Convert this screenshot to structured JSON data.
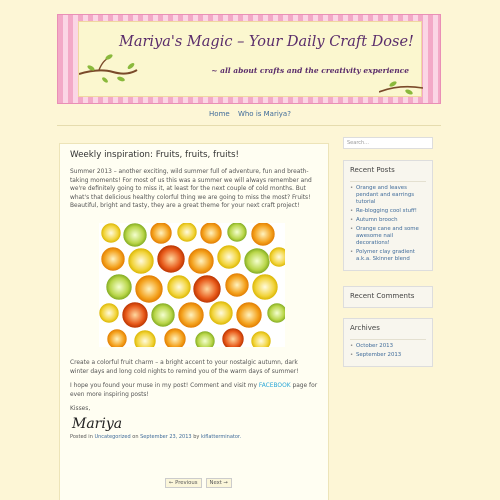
{
  "header": {
    "title": "Mariya's Magic – Your Daily Craft Dose!",
    "subtitle": "~ all about crafts and the creativity experience"
  },
  "nav": {
    "items": [
      {
        "label": "Home"
      },
      {
        "label": "Who is Mariya?"
      }
    ]
  },
  "post": {
    "title": "Weekly inspiration: Fruits, fruits, fruits!",
    "paragraph1": "Summer 2013 – another exciting, wild summer full of adventure, fun and breath-taking moments! For most of us this was a summer we will always remember and we're definitely going to miss it, at least for the next couple of cold months. But what's that delicious healthy colorful thing we are going to miss the most? Fruits! Beautiful, bright and tasty, they are a great theme for your next craft project!",
    "paragraph2": "Create a colorful fruit charm – a bright accent to your nostalgic autumn, dark winter days and long cold nights to remind you of the warm days of summer!",
    "paragraph3_before": "I hope you found your muse in my post! Comment and visit my ",
    "paragraph3_link": "FACEBOOK",
    "paragraph3_after": " page for even more inspiring posts!",
    "closing": "Kisses,",
    "signature": "Mariya",
    "meta": {
      "posted_in": "Posted in",
      "category": "Uncategorized",
      "on": "on",
      "date": "September 23, 2013",
      "by": "by",
      "author": "kiflatterminator."
    }
  },
  "pager": {
    "previous": "← Previous",
    "next": "Next →"
  },
  "sidebar": {
    "search_placeholder": "Search...",
    "recent_posts": {
      "title": "Recent Posts",
      "items": [
        "Orange and leaves pendant and earrings tutorial",
        "Re-blogging cool stuff!",
        "Autumn brooch",
        "Orange cane and some awesome nail decorations!",
        "Polymer clay gradient a.k.a. Skinner blend"
      ]
    },
    "recent_comments": {
      "title": "Recent Comments"
    },
    "archives": {
      "title": "Archives",
      "items": [
        "October 2013",
        "September 2013"
      ]
    }
  },
  "colors": {
    "background": "#fdf6d6",
    "link": "#3f6b9a",
    "facebook_link": "#2aa7d8",
    "banner_text": "#5a2d6b",
    "banner_stripes": "#f3a9c7"
  }
}
